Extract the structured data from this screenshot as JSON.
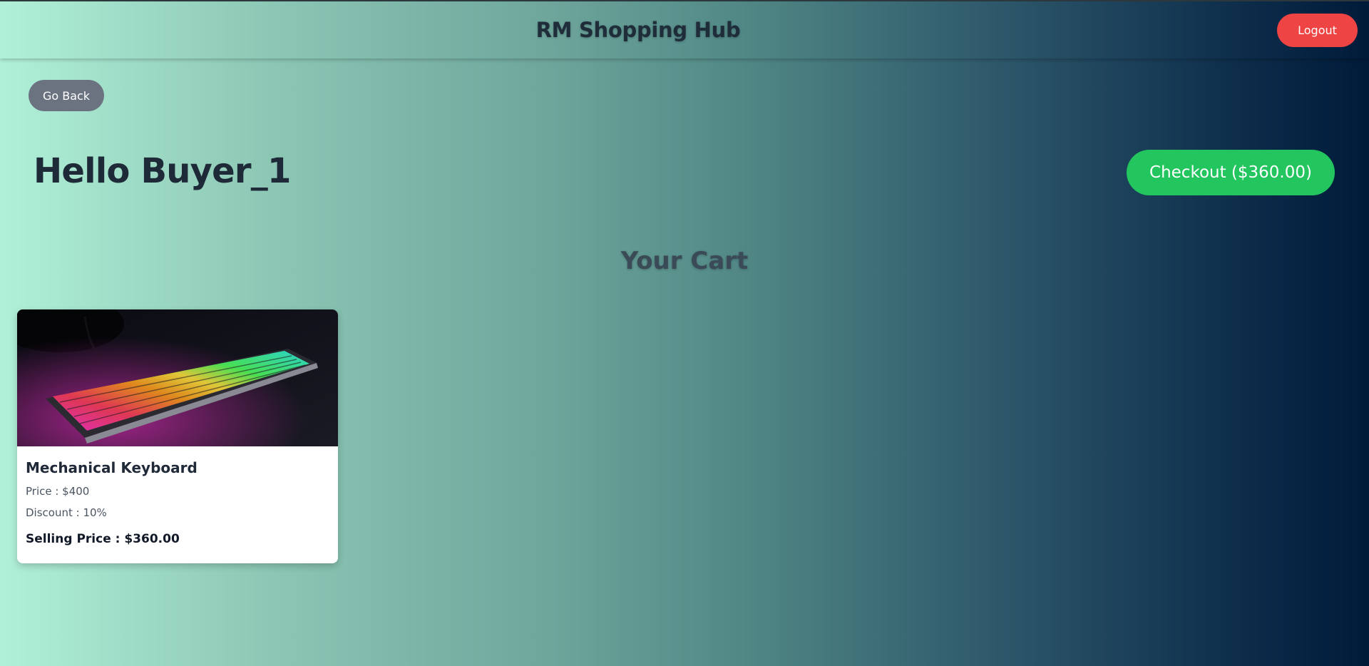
{
  "header": {
    "brand": "RM Shopping Hub",
    "logout_label": "Logout"
  },
  "nav": {
    "back_label": "Go Back"
  },
  "greeting": "Hello Buyer_1",
  "checkout": {
    "label": "Checkout ($360.00)"
  },
  "cart": {
    "title": "Your Cart",
    "items": [
      {
        "name": "Mechanical Keyboard",
        "price_text": "Price : $400",
        "discount_text": "Discount : 10%",
        "selling_price_text": "Selling Price : $360.00"
      }
    ]
  },
  "colors": {
    "logout": "#ef4444",
    "checkout": "#22c55e",
    "back": "#6b7280",
    "gradient_start": "#b0f0d8",
    "gradient_end": "#001a3a"
  }
}
